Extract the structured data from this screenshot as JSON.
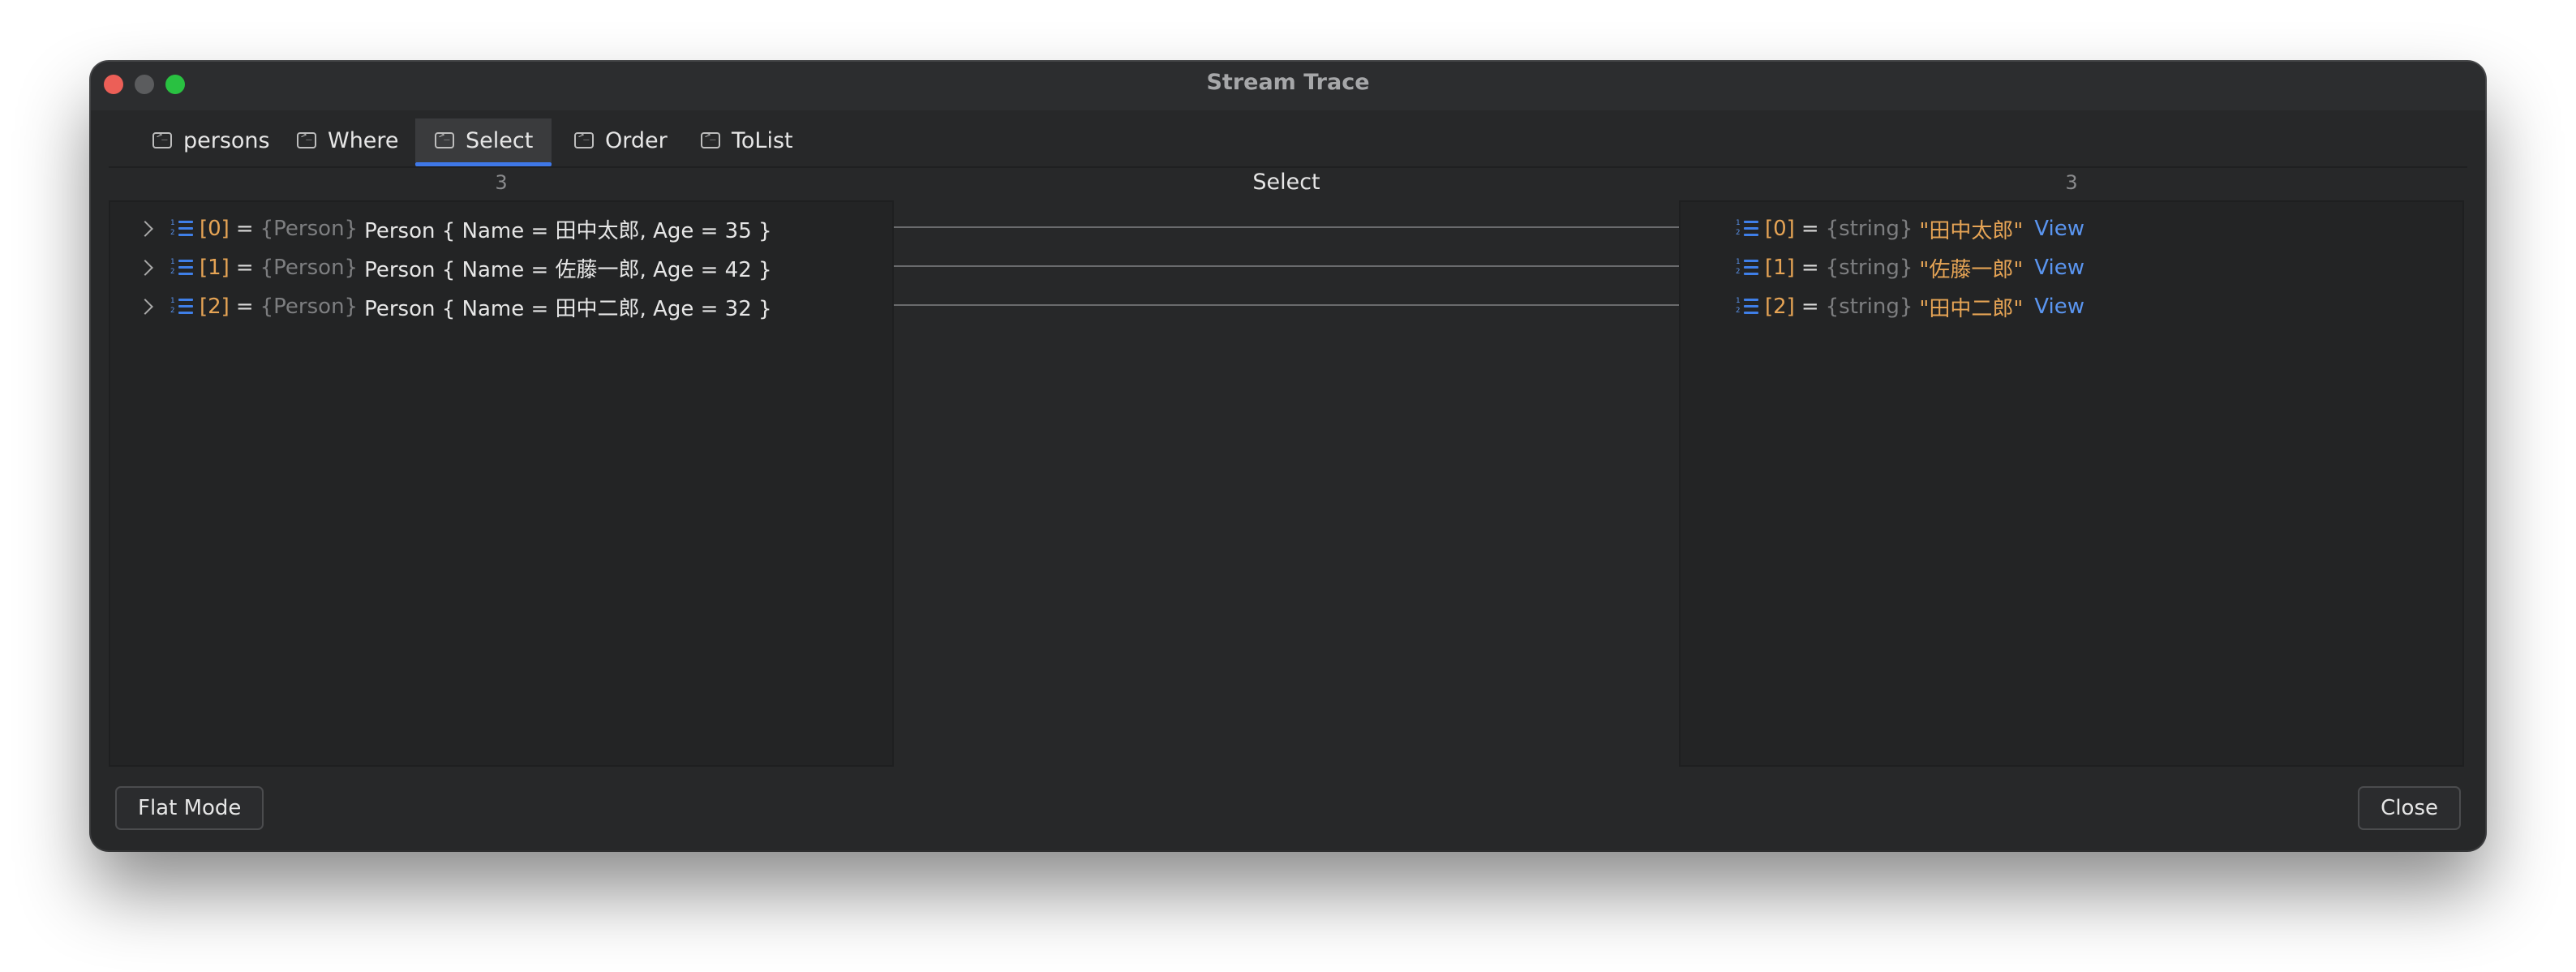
{
  "window": {
    "title": "Stream Trace"
  },
  "tabs": [
    {
      "label": "persons",
      "icon": "terminal-icon"
    },
    {
      "label": "Where",
      "icon": "terminal-icon"
    },
    {
      "label": "Select",
      "icon": "terminal-icon",
      "active": true
    },
    {
      "label": "Order",
      "icon": "terminal-icon"
    },
    {
      "label": "ToList",
      "icon": "terminal-icon"
    }
  ],
  "header": {
    "left_count": "3",
    "title": "Select",
    "right_count": "3"
  },
  "left_items": [
    {
      "index": "[0]",
      "eq": "=",
      "type": "{Person}",
      "value": "Person { Name = 田中太郎, Age = 35 }"
    },
    {
      "index": "[1]",
      "eq": "=",
      "type": "{Person}",
      "value": "Person { Name = 佐藤一郎, Age = 42 }"
    },
    {
      "index": "[2]",
      "eq": "=",
      "type": "{Person}",
      "value": "Person { Name = 田中二郎, Age = 32 }"
    }
  ],
  "right_items": [
    {
      "index": "[0]",
      "eq": "=",
      "type": "{string}",
      "value": "\"田中太郎\"",
      "link": "View"
    },
    {
      "index": "[1]",
      "eq": "=",
      "type": "{string}",
      "value": "\"佐藤一郎\"",
      "link": "View"
    },
    {
      "index": "[2]",
      "eq": "=",
      "type": "{string}",
      "value": "\"田中二郎\"",
      "link": "View"
    }
  ],
  "footer": {
    "flat_mode_label": "Flat Mode",
    "close_label": "Close"
  },
  "colors": {
    "accent": "#3f78e8",
    "index": "#e6a455",
    "link": "#5a95f0",
    "background": "#272829"
  }
}
